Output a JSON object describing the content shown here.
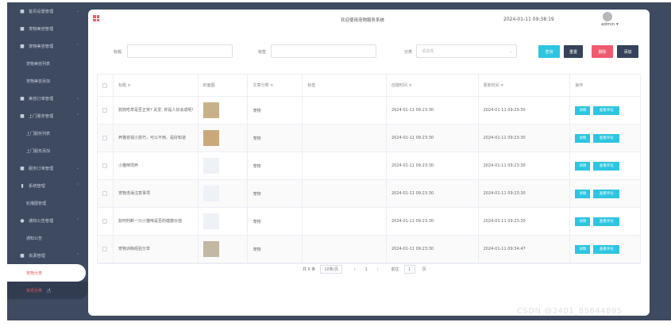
{
  "sidebar": {
    "items": [
      {
        "label": "首页设置管理",
        "type": "item",
        "icon": "square-icon",
        "chevron": "v"
      },
      {
        "label": "宠物美容管理",
        "type": "item",
        "icon": "square-icon",
        "chevron": ""
      },
      {
        "label": "宠物美容管理",
        "type": "item",
        "icon": "square-icon",
        "chevron": "^"
      },
      {
        "label": "宠物美容列表",
        "type": "sub"
      },
      {
        "label": "宠物美容添加",
        "type": "sub"
      },
      {
        "label": "美容订单管理",
        "type": "item",
        "icon": "square-icon",
        "chevron": "v"
      },
      {
        "label": "上门服务管理",
        "type": "item",
        "icon": "square-icon",
        "chevron": "^"
      },
      {
        "label": "上门服务列表",
        "type": "sub"
      },
      {
        "label": "上门服务添加",
        "type": "sub"
      },
      {
        "label": "服务订单管理",
        "type": "item",
        "icon": "square-icon",
        "chevron": "v"
      },
      {
        "label": "系统管理",
        "type": "item",
        "icon": "bar-chart-icon",
        "chevron": "^"
      },
      {
        "label": "轮播图管理",
        "type": "sub"
      },
      {
        "label": "通知公告管理",
        "type": "item",
        "icon": "info-icon",
        "chevron": "^"
      },
      {
        "label": "通知公告",
        "type": "sub"
      },
      {
        "label": "资源管理",
        "type": "item",
        "icon": "square-icon",
        "chevron": "^"
      },
      {
        "label": "宠物分类",
        "type": "active"
      },
      {
        "label": "资讯分类",
        "type": "last"
      }
    ]
  },
  "header": {
    "title": "欢迎使用宠物服务系统",
    "clock": "2024-01-11 09:38:19",
    "user": "admin ▾"
  },
  "search": {
    "title_label": "标题",
    "tags_label": "标签",
    "category_label": "分类",
    "category_placeholder": "请选择",
    "buttons": {
      "query": "查询",
      "reset": "重置",
      "delete": "删除",
      "add": "添加"
    }
  },
  "table": {
    "headers": [
      "",
      "标题 ≑",
      "封面图",
      "文章分类 ≑",
      "标签",
      "创建时间 ≑",
      "更新时间 ≑",
      "操作"
    ],
    "rows": [
      {
        "title": "狗狗吃草是否正常? 关爱: 你是人好会成呢!",
        "thumb": "t1",
        "category": "宠物",
        "tags": "",
        "created": "2024-01-11 09:23:30",
        "updated": "2024-01-11 09:23:30"
      },
      {
        "title": "养猫省钱小技巧，可以不用、是好知道",
        "thumb": "t2",
        "category": "宠物",
        "tags": "",
        "created": "2024-01-11 09:23:30",
        "updated": "2024-01-11 09:23:30"
      },
      {
        "title": "小猫咪饲养",
        "thumb": "e",
        "category": "宠物",
        "tags": "",
        "created": "2024-01-11 09:23:30",
        "updated": "2024-01-11 09:23:30"
      },
      {
        "title": "宠物洗澡注意事项",
        "thumb": "e",
        "category": "宠物",
        "tags": "",
        "created": "2024-01-11 09:23:30",
        "updated": "2024-01-11 09:23:30"
      },
      {
        "title": "如何判断一只小猫咪是否的健康价值",
        "thumb": "e",
        "category": "宠物",
        "tags": "",
        "created": "2024-01-11 09:23:30",
        "updated": "2024-01-11 09:23:30"
      },
      {
        "title": "宠物训练经验分享",
        "thumb": "t6",
        "category": "宠物",
        "tags": "",
        "created": "2024-01-11 09:23:30",
        "updated": "2024-01-11 09:34:47"
      }
    ],
    "action_edit": "详情",
    "action_comment": "查看评论"
  },
  "pager": {
    "total": "共 6 条",
    "size": "10条/页",
    "prev": "‹",
    "page": "1",
    "next": "›",
    "goto": "前往",
    "goto_val": "1",
    "page_unit": "页"
  },
  "watermark": "CSDN @2401_85644895"
}
